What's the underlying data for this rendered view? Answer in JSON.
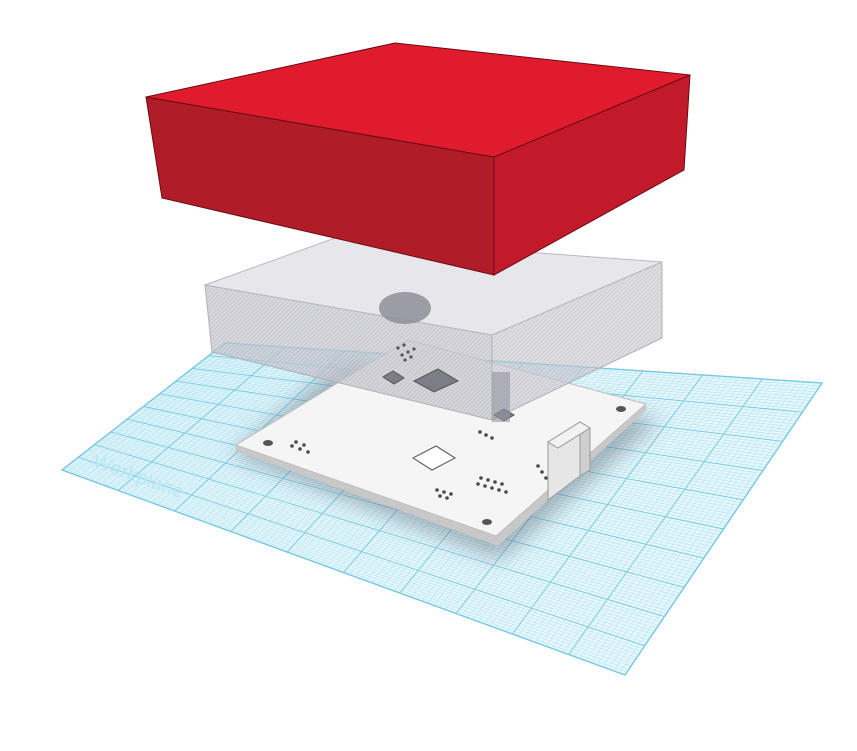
{
  "workplane": {
    "label": "Workplane",
    "grid_color": "#7fd0e8",
    "fill_color": "#dff4fb"
  },
  "scene": {
    "objects": [
      {
        "name": "red-box",
        "color": "#c0192a"
      },
      {
        "name": "hole-box",
        "color": "#9a9aa4"
      },
      {
        "name": "circuit-board",
        "color": "#f4f4f4"
      }
    ]
  }
}
